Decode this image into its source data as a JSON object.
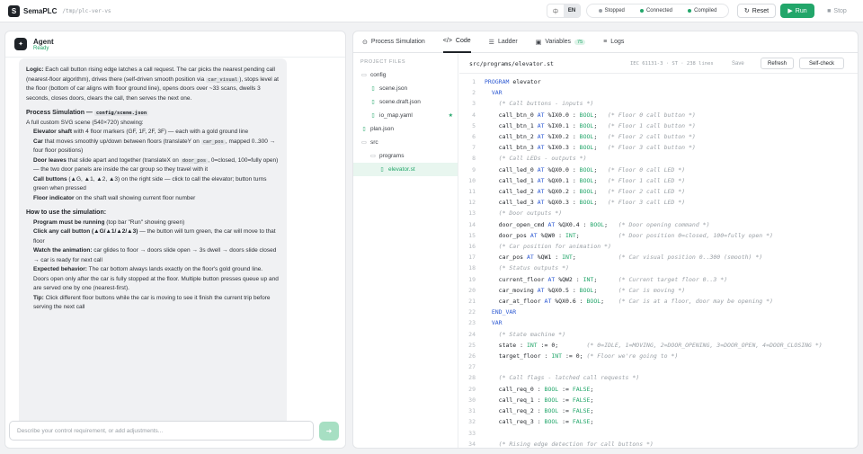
{
  "app": {
    "name": "SemaPLC",
    "path": "/tmp/plc-ver-vs",
    "logo_icon": "S"
  },
  "lang": {
    "zh": "中",
    "en": "EN"
  },
  "status": [
    {
      "label": "Stopped",
      "color": "#9aa0a6"
    },
    {
      "label": "Connected",
      "color": "#22a66a"
    },
    {
      "label": "Compiled",
      "color": "#22a66a"
    }
  ],
  "toolbar": {
    "reset": "Reset",
    "run": "Run",
    "stop": "Stop",
    "accent": "#22a66a"
  },
  "agent": {
    "title": "Agent",
    "state": "Ready",
    "message": {
      "logic_label": "Logic:",
      "logic_text": " Each call button rising edge latches a call request. The car picks the nearest pending call (nearest-floor algorithm), drives there (self-driven smooth position via ",
      "logic_code": "car_visual",
      "logic_text2": "), stops level at the floor (bottom of car aligns with floor ground line), opens doors over ~33 scans, dwells 3 seconds, closes doors, clears the call, then serves the next one.",
      "sim_heading": "Process Simulation —",
      "sim_code": "config/scene.json",
      "sim_intro": "A full custom SVG scene (540×720) showing:",
      "items": [
        {
          "b": "Elevator shaft",
          "t": " with 4 floor markers (GF, 1F, 2F, 3F) — each with a gold ground line"
        },
        {
          "b": "Car",
          "t": " that moves smoothly up/down between floors (translateY on ",
          "code": "car_pos",
          "t2": ", mapped 0..300 → four floor positions)"
        },
        {
          "b": "Door leaves",
          "t": " that slide apart and together (translateX on ",
          "code": "door_pos",
          "t2": ", 0=closed, 100=fully open) — the two door panels are inside the car group so they travel with it"
        },
        {
          "b": "Call buttons",
          "t": " (▲G, ▲1, ▲2, ▲3) on the right side — click to call the elevator; button turns green when pressed"
        },
        {
          "b": "Floor indicator",
          "t": " on the shaft wall showing current floor number"
        }
      ],
      "howto_heading": "How to use the simulation:",
      "steps": [
        {
          "b": "Program must be running",
          "t": " (top bar \"Run\" showing green)"
        },
        {
          "b": "Click any call button (▲G/▲1/▲2/▲3)",
          "t": " — the button will turn green, the car will move to that floor"
        },
        {
          "b": "Watch the animation:",
          "t": " car glides to floor → doors slide open → 3s dwell → doors slide closed → car is ready for next call"
        },
        {
          "b": "Expected behavior:",
          "t": " The car bottom always lands exactly on the floor's gold ground line. Doors open only after the car is fully stopped at the floor. Multiple button presses queue up and are served one by one (nearest-first)."
        },
        {
          "b": "Tip:",
          "t": " Click different floor buttons while the car is moving to see it finish the current trip before serving the next call"
        }
      ]
    },
    "input_placeholder": "Describe your control requirement, or add adjustments..."
  },
  "tabs": [
    {
      "label": "Process Simulation",
      "icon": "grid-icon"
    },
    {
      "label": "Code",
      "icon": "code-icon",
      "active": true
    },
    {
      "label": "Ladder",
      "icon": "ladder-icon"
    },
    {
      "label": "Variables",
      "icon": "variables-icon",
      "badge": "75"
    },
    {
      "label": "Logs",
      "icon": "logs-icon"
    }
  ],
  "tree": {
    "title": "PROJECT FILES",
    "nodes": [
      {
        "label": "config",
        "type": "folder"
      },
      {
        "label": "scene.json",
        "type": "file"
      },
      {
        "label": "scene.draft.json",
        "type": "file"
      },
      {
        "label": "io_map.yaml",
        "type": "file",
        "starred": true
      },
      {
        "label": "plan.json",
        "type": "file"
      },
      {
        "label": "src",
        "type": "folder"
      },
      {
        "label": "programs",
        "type": "folder"
      },
      {
        "label": "elevator.st",
        "type": "file",
        "selected": true
      }
    ]
  },
  "editor": {
    "path": "src/programs/elevator.st",
    "info": "IEC 61131-3 · ST · 238 lines",
    "save": "Save",
    "refresh": "Refresh",
    "selfcheck": "Self-check",
    "lines": [
      "PROGRAM elevator",
      "  VAR",
      "    (* Call buttons - inputs *)",
      "    call_btn_0 AT %IX0.0 : BOOL;   (* Floor 0 call button *)",
      "    call_btn_1 AT %IX0.1 : BOOL;   (* Floor 1 call button *)",
      "    call_btn_2 AT %IX0.2 : BOOL;   (* Floor 2 call button *)",
      "    call_btn_3 AT %IX0.3 : BOOL;   (* Floor 3 call button *)",
      "    (* Call LEDs - outputs *)",
      "    call_led_0 AT %QX0.0 : BOOL;   (* Floor 0 call LED *)",
      "    call_led_1 AT %QX0.1 : BOOL;   (* Floor 1 call LED *)",
      "    call_led_2 AT %QX0.2 : BOOL;   (* Floor 2 call LED *)",
      "    call_led_3 AT %QX0.3 : BOOL;   (* Floor 3 call LED *)",
      "    (* Door outputs *)",
      "    door_open_cmd AT %QX0.4 : BOOL;   (* Door opening command *)",
      "    door_pos AT %QW0 : INT;           (* Door position 0=closed, 100=fully open *)",
      "    (* Car position for animation *)",
      "    car_pos AT %QW1 : INT;            (* Car visual position 0..300 (smooth) *)",
      "    (* Status outputs *)",
      "    current_floor AT %QW2 : INT;      (* Current target floor 0..3 *)",
      "    car_moving AT %QX0.5 : BOOL;      (* Car is moving *)",
      "    car_at_floor AT %QX0.6 : BOOL;    (* Car is at a floor, door may be opening *)",
      "  END_VAR",
      "  VAR",
      "    (* State machine *)",
      "    state : INT := 0;        (* 0=IDLE, 1=MOVING, 2=DOOR_OPENING, 3=DOOR_OPEN, 4=DOOR_CLOSING *)",
      "    target_floor : INT := 0; (* Floor we're going to *)",
      "",
      "    (* Call flags - latched call requests *)",
      "    call_req_0 : BOOL := FALSE;",
      "    call_req_1 : BOOL := FALSE;",
      "    call_req_2 : BOOL := FALSE;",
      "    call_req_3 : BOOL := FALSE;",
      "",
      "    (* Rising edge detection for call buttons *)"
    ]
  }
}
